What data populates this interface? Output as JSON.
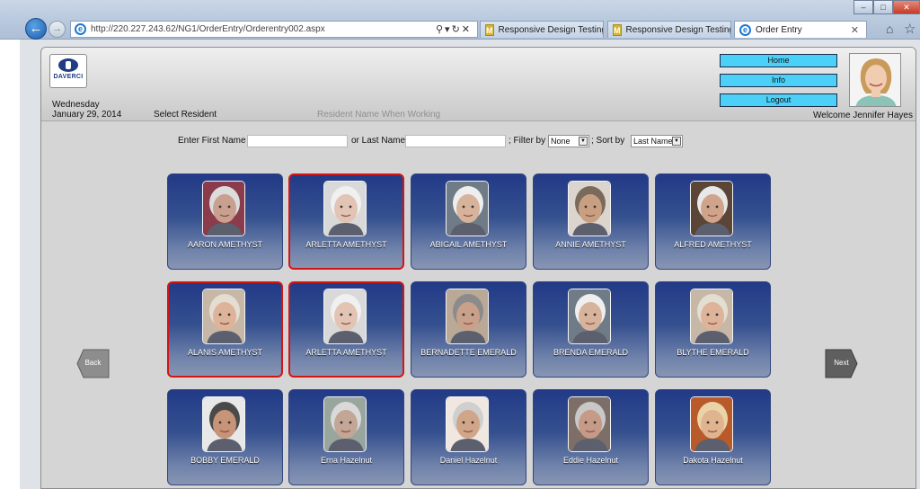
{
  "browser": {
    "address": "http://220.227.243.62/NG1/OrderEntry/Orderentry002.aspx",
    "tabs": [
      "Responsive Design Testing",
      "Responsive Design Testing",
      "Order Entry"
    ]
  },
  "header": {
    "logo_text": "DAVERCI",
    "day": "Wednesday",
    "date": "January 29, 2014",
    "select_resident": "Select Resident",
    "resident_hint": "Resident Name When Working",
    "buttons": [
      "Home",
      "Info",
      "Logout"
    ],
    "welcome": "Welcome Jennifer Hayes"
  },
  "filters": {
    "first_name_label": "Enter First Name",
    "last_name_label": "or Last Name",
    "filter_label": "; Filter by",
    "filter_value": "None",
    "sort_label": "; Sort by",
    "sort_value": "Last Name"
  },
  "navigation": {
    "back": "Back",
    "next": "Next"
  },
  "residents": [
    {
      "name": "AARON AMETHYST",
      "selected": false,
      "skin": "#c9a08f",
      "hair": "#dcdcdc",
      "bg": "#8a3b4c"
    },
    {
      "name": "ARLETTA AMETHYST",
      "selected": true,
      "skin": "#e2c4b4",
      "hair": "#f0f0f0",
      "bg": "#d9d9d9"
    },
    {
      "name": "ABIGAIL AMETHYST",
      "selected": false,
      "skin": "#d7b39c",
      "hair": "#eeeeee",
      "bg": "#6f7b86"
    },
    {
      "name": "ANNIE AMETHYST",
      "selected": false,
      "skin": "#c99f82",
      "hair": "#7a6a5c",
      "bg": "#dcd5cd"
    },
    {
      "name": "ALFRED AMETHYST",
      "selected": false,
      "skin": "#d0a48b",
      "hair": "#e8e8e8",
      "bg": "#5a4536"
    },
    {
      "name": "ALANIS AMETHYST",
      "selected": true,
      "skin": "#ddb49a",
      "hair": "#e4ddd2",
      "bg": "#c7b7a6"
    },
    {
      "name": "ARLETTA AMETHYST",
      "selected": true,
      "skin": "#e2c4b4",
      "hair": "#f0f0f0",
      "bg": "#d9d9d9"
    },
    {
      "name": "BERNADETTE EMERALD",
      "selected": false,
      "skin": "#c9a08a",
      "hair": "#8b8b8b",
      "bg": "#b9a996"
    },
    {
      "name": "BRENDA EMERALD",
      "selected": false,
      "skin": "#d7b39c",
      "hair": "#efefef",
      "bg": "#6f7b86"
    },
    {
      "name": "BLYTHE EMERALD",
      "selected": false,
      "skin": "#ddb49a",
      "hair": "#e4ddd2",
      "bg": "#c7b7a6"
    },
    {
      "name": "BOBBY EMERALD",
      "selected": false,
      "skin": "#c79478",
      "hair": "#4a4a4a",
      "bg": "#e8e8e8"
    },
    {
      "name": "Erna Hazelnut",
      "selected": false,
      "skin": "#c3a695",
      "hair": "#d9d9d9",
      "bg": "#98a69e"
    },
    {
      "name": "Daniel Hazelnut",
      "selected": false,
      "skin": "#d1a588",
      "hair": "#cfcfcf",
      "bg": "#f0e8e0"
    },
    {
      "name": "Eddie Hazelnut",
      "selected": false,
      "skin": "#c59a86",
      "hair": "#c8c8c8",
      "bg": "#7d6f68"
    },
    {
      "name": "Dakota Hazelnut",
      "selected": false,
      "skin": "#e0b48f",
      "hair": "#e9d4a8",
      "bg": "#b85a2a"
    }
  ],
  "colors": {
    "tile_top": "#223a87",
    "selected_border": "#d21616",
    "header_button": "#4bd0f7"
  }
}
